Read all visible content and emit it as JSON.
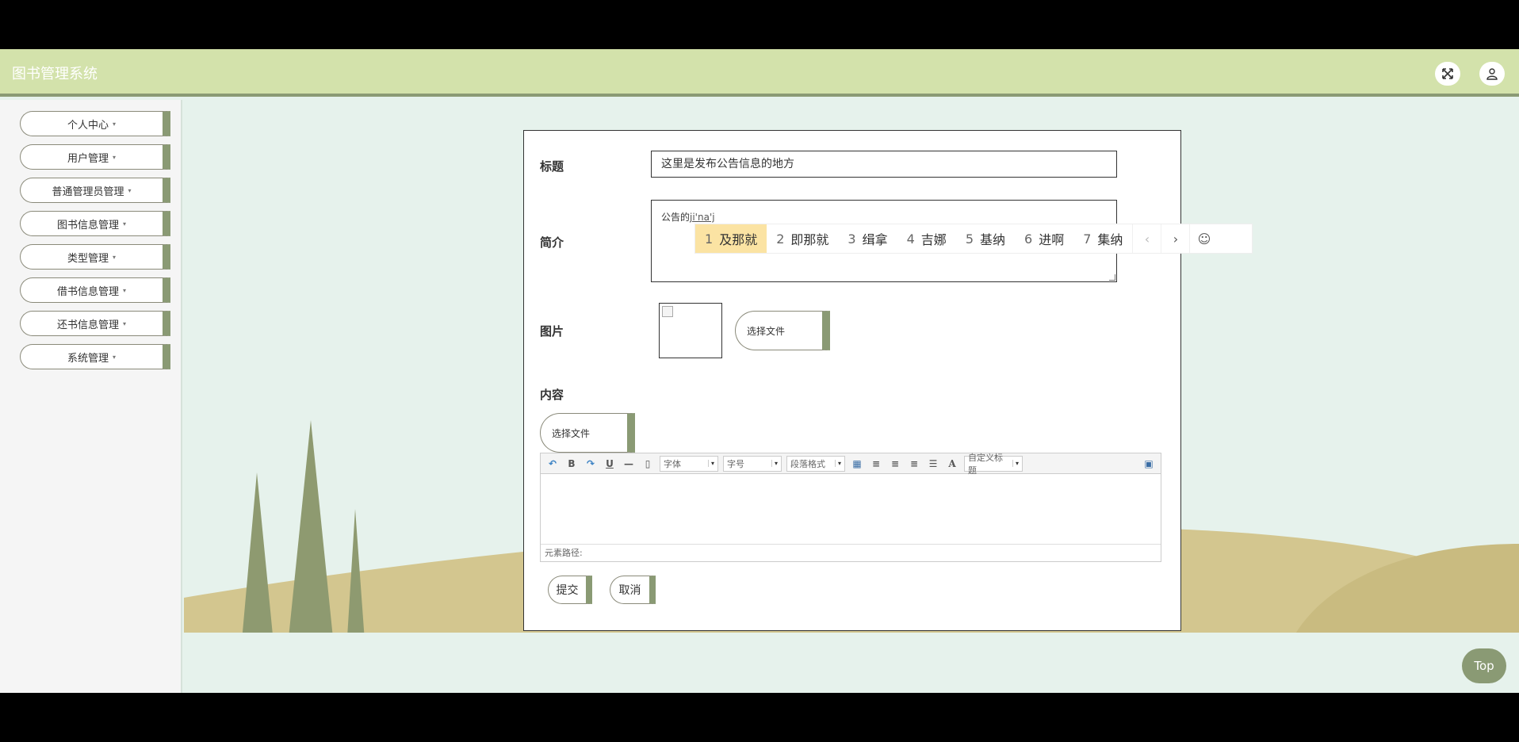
{
  "header": {
    "title": "图书管理系统",
    "fullscreen_icon": "expand-arrows-icon",
    "user_icon": "user-icon"
  },
  "sidebar": {
    "items": [
      {
        "label": "个人中心"
      },
      {
        "label": "用户管理"
      },
      {
        "label": "普通管理员管理"
      },
      {
        "label": "图书信息管理"
      },
      {
        "label": "类型管理"
      },
      {
        "label": "借书信息管理"
      },
      {
        "label": "还书信息管理"
      },
      {
        "label": "系统管理"
      }
    ],
    "caret": "▾"
  },
  "form": {
    "title_label": "标题",
    "title_value": "这里是发布公告信息的地方",
    "summary_label": "简介",
    "summary_text": "公告的",
    "summary_composing": "ji'na'j",
    "image_label": "图片",
    "image_upload_button": "选择文件",
    "content_label": "内容",
    "content_upload_button": "选择文件",
    "editor": {
      "font_select": "字体",
      "size_select": "字号",
      "paragraph_select": "段落格式",
      "custom_title_select": "自定义标题",
      "path_label": "元素路径:"
    },
    "submit_button": "提交",
    "cancel_button": "取消"
  },
  "ime": {
    "candidates": [
      {
        "num": "1",
        "text": "及那就"
      },
      {
        "num": "2",
        "text": "即那就"
      },
      {
        "num": "3",
        "text": "缉拿"
      },
      {
        "num": "4",
        "text": "吉娜"
      },
      {
        "num": "5",
        "text": "基纳"
      },
      {
        "num": "6",
        "text": "进啊"
      },
      {
        "num": "7",
        "text": "集纳"
      }
    ],
    "prev": "‹",
    "next": "›",
    "emoji": "☺"
  },
  "top_button": "Top",
  "colors": {
    "accent": "#8a9a74",
    "header_bg": "#d3e2ab",
    "content_bg": "#e6f2ec",
    "hill": "#d3c68f",
    "tree": "#8e9a70"
  }
}
